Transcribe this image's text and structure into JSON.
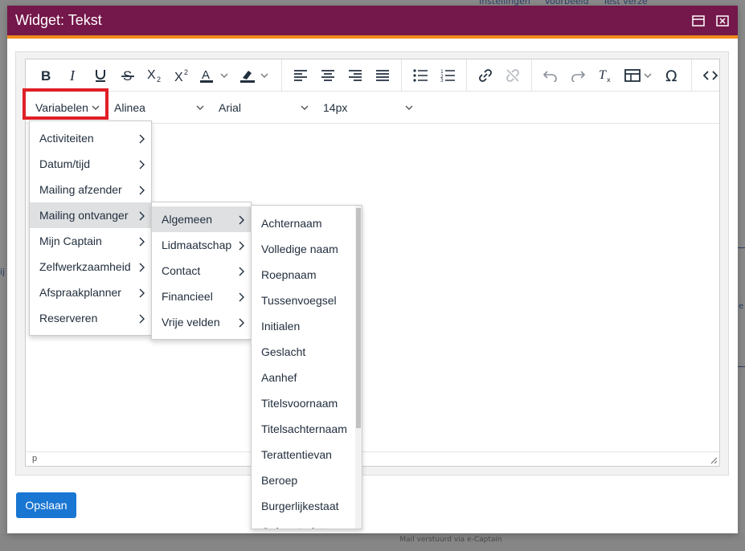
{
  "background": {
    "topbar": [
      "Instellingen",
      "Voorbeeld",
      "Test verze"
    ],
    "footer": "Mail verstuurd via e-Captain",
    "left_fragment": "ij",
    "right_fragment": "e"
  },
  "dialog": {
    "title": "Widget: Tekst",
    "header_color": "#74174a",
    "accent_color": "#f08a1c"
  },
  "toolbar": {
    "icons": [
      "bold-icon",
      "italic-icon",
      "underline-icon",
      "strikethrough-icon",
      "subscript-icon",
      "superscript-icon",
      "text-color-icon",
      "highlight-color-icon",
      "align-left-icon",
      "align-center-icon",
      "align-right-icon",
      "justify-icon",
      "bullet-list-icon",
      "numbered-list-icon",
      "link-icon",
      "unlink-icon",
      "undo-icon",
      "redo-icon",
      "clear-format-icon",
      "table-icon",
      "special-char-icon",
      "source-code-icon"
    ]
  },
  "toolbar2": {
    "variables_label": "Variabelen",
    "format_value": "Alinea",
    "font_value": "Arial",
    "size_value": "14px"
  },
  "statusbar": {
    "path": "p"
  },
  "save_label": "Opslaan",
  "menu1": {
    "items": [
      "Activiteiten",
      "Datum/tijd",
      "Mailing afzender",
      "Mailing ontvanger",
      "Mijn Captain",
      "Zelfwerkzaamheid",
      "Afspraakplanner",
      "Reserveren"
    ],
    "active": "Mailing ontvanger"
  },
  "menu2": {
    "items": [
      "Algemeen",
      "Lidmaatschap",
      "Contact",
      "Financieel",
      "Vrije velden"
    ],
    "active": "Algemeen"
  },
  "menu3": {
    "items": [
      "Achternaam",
      "Volledige naam",
      "Roepnaam",
      "Tussenvoegsel",
      "Initialen",
      "Geslacht",
      "Aanhef",
      "Titelsvoornaam",
      "Titelsachternaam",
      "Terattentievan",
      "Beroep",
      "Burgerlijkestaat",
      "Geboortedatum"
    ]
  }
}
